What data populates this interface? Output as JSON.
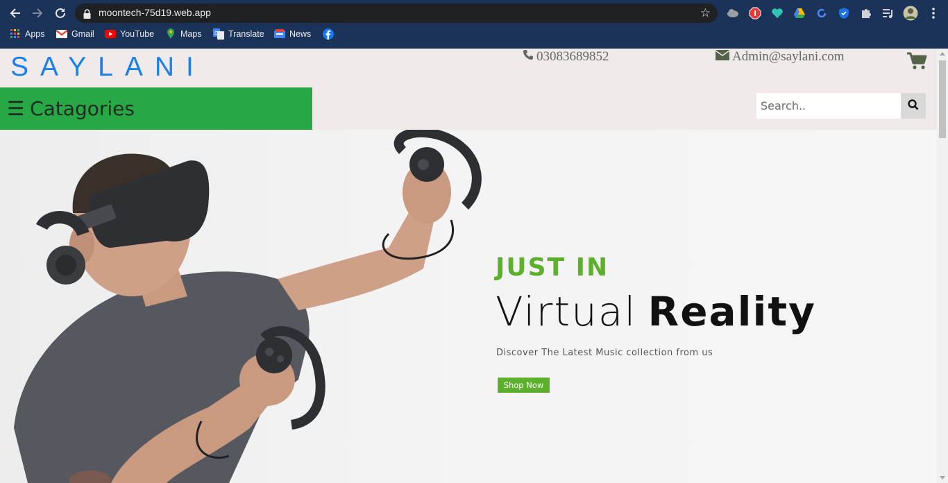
{
  "browser": {
    "url": "moontech-75d19.web.app",
    "bookmarks": [
      {
        "label": "Apps",
        "icon": "apps-grid-icon"
      },
      {
        "label": "Gmail",
        "icon": "gmail-icon"
      },
      {
        "label": "YouTube",
        "icon": "youtube-icon"
      },
      {
        "label": "Maps",
        "icon": "maps-icon"
      },
      {
        "label": "Translate",
        "icon": "translate-icon"
      },
      {
        "label": "News",
        "icon": "news-icon"
      },
      {
        "label": "",
        "icon": "facebook-icon"
      }
    ]
  },
  "header": {
    "brand": "SAYLANI",
    "phone": "03083689852",
    "email": "Admin@saylani.com",
    "categories_label": "Catagories",
    "search_placeholder": "Search.."
  },
  "hero": {
    "kicker": "JUST IN",
    "title_light": "Virtual",
    "title_bold": "Reality",
    "subtitle": "Discover The Latest Music collection from us",
    "cta": "Shop Now"
  },
  "colors": {
    "brand_blue": "#1a80ea",
    "category_green": "#28a745",
    "accent_green": "#5cb02c",
    "chrome_bg": "#1b3358",
    "header_bg": "#f0eaea"
  }
}
